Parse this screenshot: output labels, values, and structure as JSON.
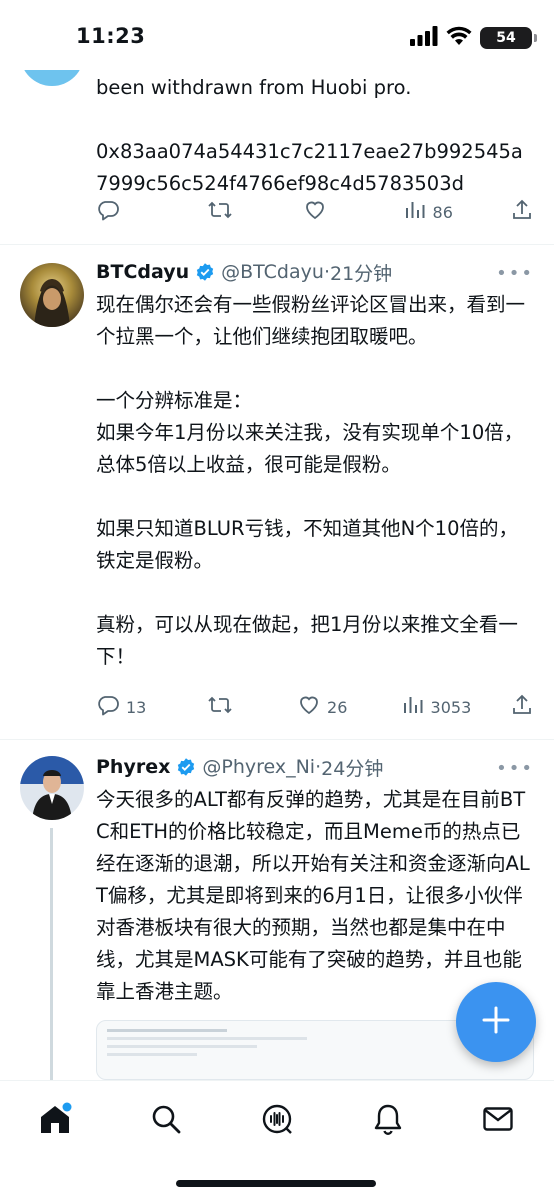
{
  "status_bar": {
    "time": "11:23",
    "battery": "54"
  },
  "tweets": [
    {
      "text_partial": "been withdrawn from Huobi pro.\n\n0x83aa074a54431c7c2117eae27b992545a7999c56c524f4766ef98c4d5783503d",
      "views": "86"
    },
    {
      "name": "BTCdayu",
      "handle": "@BTCdayu",
      "sep": "·",
      "time": "21分钟",
      "text": "现在偶尔还会有一些假粉丝评论区冒出来，看到一个拉黑一个，让他们继续抱团取暖吧。\n\n一个分辨标准是：\n如果今年1月份以来关注我，没有实现单个10倍，总体5倍以上收益，很可能是假粉。\n\n如果只知道BLUR亏钱，不知道其他N个10倍的，铁定是假粉。\n\n真粉，可以从现在做起，把1月份以来推文全看一下！",
      "replies": "13",
      "retweets": "",
      "likes": "26",
      "views": "3053"
    },
    {
      "name": "Phyrex",
      "handle": "@Phyrex_Ni",
      "sep": "·",
      "time": "24分钟",
      "text": "今天很多的ALT都有反弹的趋势，尤其是在目前BTC和ETH的价格比较稳定，而且Meme币的热点已经在逐渐的退潮，所以开始有关注和资金逐渐向ALT偏移，尤其是即将到来的6月1日，让很多小伙伴对香港板块有很大的预期，当然也都是集中在中线，尤其是MASK可能有了突破的趋势，并且也能靠上香港主题。"
    }
  ],
  "colors": {
    "accent": "#1d9bf0",
    "fab": "#3b93f0",
    "secondary_text": "#536471"
  },
  "icons": {
    "actions": [
      "reply-icon",
      "retweet-icon",
      "like-icon",
      "views-icon",
      "share-icon"
    ],
    "nav": [
      "home-icon",
      "search-icon",
      "spaces-icon",
      "notifications-icon",
      "messages-icon"
    ],
    "fab": "compose-plus-icon"
  }
}
